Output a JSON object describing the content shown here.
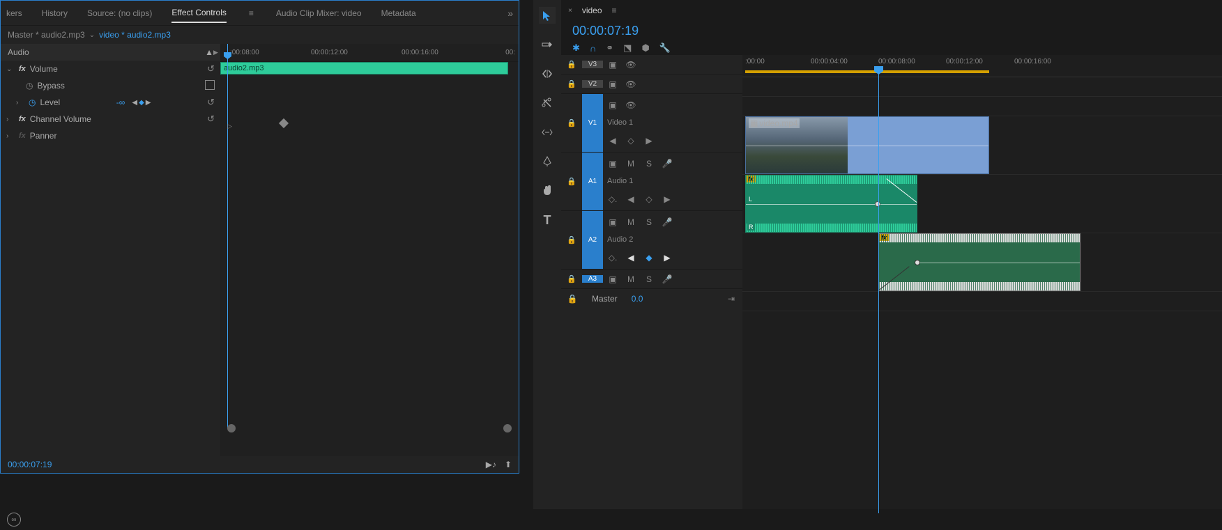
{
  "tabs": [
    "kers",
    "History",
    "Source: (no clips)",
    "Effect Controls",
    "Audio Clip Mixer: video",
    "Metadata"
  ],
  "active_tab": "Effect Controls",
  "ec": {
    "master": "Master * audio2.mp3",
    "clip": "video * audio2.mp3",
    "ruler": [
      ":00:08:00",
      "00:00:12:00",
      "00:00:16:00",
      "00:"
    ],
    "clip_name": "audio2.mp3",
    "section": "Audio",
    "volume": "Volume",
    "bypass": "Bypass",
    "level": "Level",
    "level_value": "-∞",
    "channel_volume": "Channel Volume",
    "panner": "Panner",
    "timecode": "00:00:07:19"
  },
  "timeline": {
    "tab": "video",
    "timecode": "00:00:07:19",
    "ruler": [
      ":00:00",
      "00:00:04:00",
      "00:00:08:00",
      "00:00:12:00",
      "00:00:16:00"
    ],
    "tracks": {
      "v3": "V3",
      "v2": "V2",
      "v1": "V1",
      "v1_name": "Video 1",
      "a1": "A1",
      "a1_name": "Audio 1",
      "a2": "A2",
      "a2_name": "Audio 2",
      "a3": "A3",
      "master": "Master",
      "master_value": "0.0"
    },
    "clips": {
      "video": "video.mp4",
      "ch_l": "L",
      "ch_r": "R"
    }
  },
  "icons": {
    "M": "M",
    "S": "S"
  }
}
